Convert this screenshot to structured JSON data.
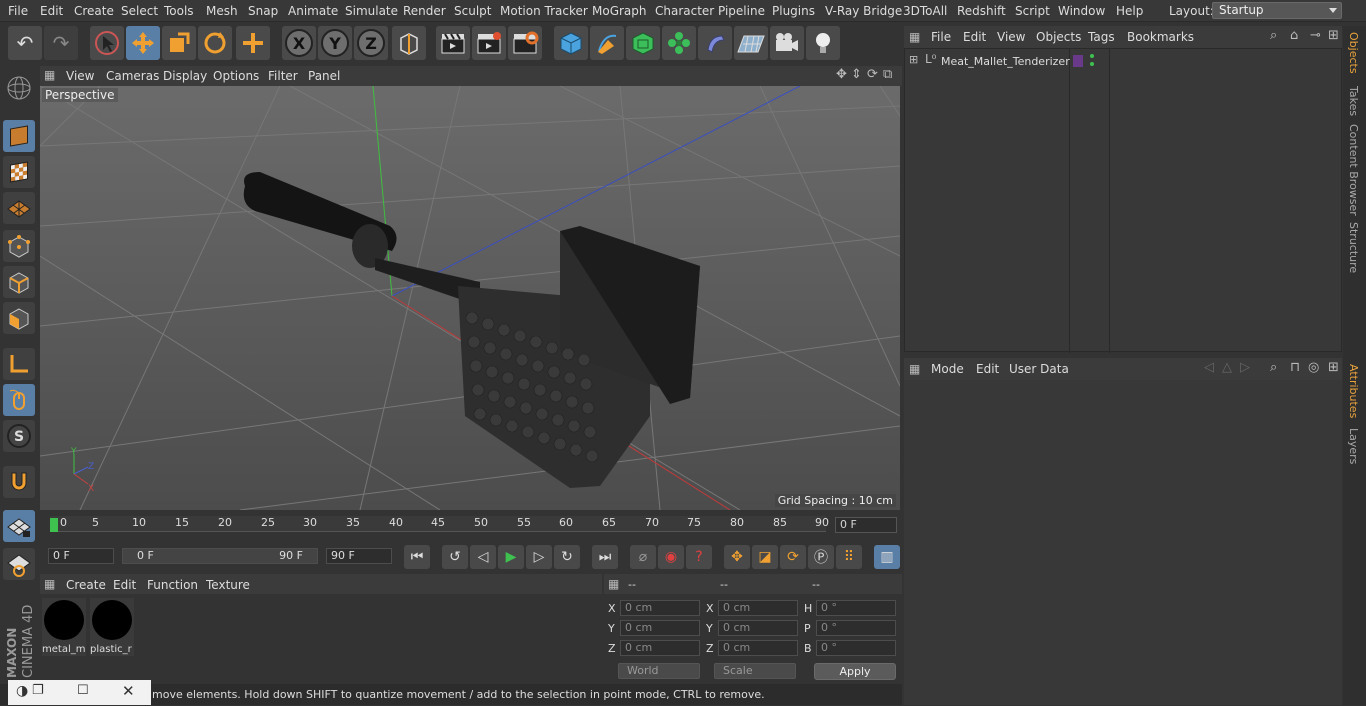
{
  "menubar": {
    "items": [
      "File",
      "Edit",
      "Create",
      "Select",
      "Tools",
      "Mesh",
      "Snap",
      "Animate",
      "Simulate",
      "Render",
      "Sculpt",
      "Motion Tracker",
      "MoGraph",
      "Character",
      "Pipeline",
      "Plugins",
      "V-Ray Bridge",
      "3DToAll",
      "Redshift",
      "Script",
      "Window",
      "Help"
    ],
    "layout_label": "Layout:",
    "layout_value": "Startup"
  },
  "toolbar": {
    "undo": "undo-icon",
    "redo": "redo-icon",
    "x_label": "X",
    "y_label": "Y",
    "z_label": "Z"
  },
  "viewport": {
    "menu": [
      "View",
      "Cameras",
      "Display",
      "Options",
      "Filter",
      "Panel"
    ],
    "camera_label": "Perspective",
    "grid_spacing": "Grid Spacing : 10 cm",
    "axis_labels": [
      "Y",
      "Z",
      "X"
    ]
  },
  "timeline": {
    "ticks": [
      "0",
      "5",
      "10",
      "15",
      "20",
      "25",
      "30",
      "35",
      "40",
      "45",
      "50",
      "55",
      "60",
      "65",
      "70",
      "75",
      "80",
      "85",
      "90"
    ],
    "current_frame": "0 F"
  },
  "transport": {
    "start_frame": "0 F",
    "range_start": "0 F",
    "range_end": "90 F",
    "end_frame": "90 F"
  },
  "materials": {
    "menu": [
      "Create",
      "Edit",
      "Function",
      "Texture"
    ],
    "items": [
      {
        "label": "metal_m"
      },
      {
        "label": "plastic_r"
      }
    ]
  },
  "coordinates": {
    "headers": [
      "--",
      "--",
      "--"
    ],
    "rows": [
      {
        "a_label": "X",
        "a_val": "0 cm",
        "b_label": "X",
        "b_val": "0 cm",
        "c_label": "H",
        "c_val": "0 °"
      },
      {
        "a_label": "Y",
        "a_val": "0 cm",
        "b_label": "Y",
        "b_val": "0 cm",
        "c_label": "P",
        "c_val": "0 °"
      },
      {
        "a_label": "Z",
        "a_val": "0 cm",
        "b_label": "Z",
        "b_val": "0 cm",
        "c_label": "B",
        "c_val": "0 °"
      }
    ],
    "space": "World",
    "mode": "Scale",
    "apply": "Apply"
  },
  "status": {
    "text": "move elements. Hold down SHIFT to quantize movement / add to the selection in point mode, CTRL to remove."
  },
  "objects_panel": {
    "menu": [
      "File",
      "Edit",
      "View",
      "Objects",
      "Tags",
      "Bookmarks"
    ],
    "object_name": "Meat_Mallet_Tenderizer"
  },
  "attributes_panel": {
    "menu": [
      "Mode",
      "Edit",
      "User Data"
    ]
  },
  "side_tabs": [
    "Objects",
    "Takes",
    "Content Browser",
    "Structure",
    "Attributes",
    "Layers"
  ],
  "branding": {
    "maxon": "MAXON",
    "product": "CINEMA 4D"
  },
  "colors": {
    "accent": "#5a7fa6",
    "tab_active": "#e8a23c",
    "play": "#3fc150"
  }
}
